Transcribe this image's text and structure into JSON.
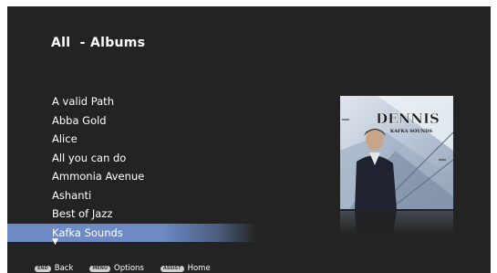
{
  "header": {
    "title": "All  - Albums"
  },
  "albums": [
    {
      "label": "A valid Path"
    },
    {
      "label": "Abba Gold"
    },
    {
      "label": "Alice"
    },
    {
      "label": "All you can do"
    },
    {
      "label": "Ammonia Avenue"
    },
    {
      "label": "Ashanti"
    },
    {
      "label": "Best of Jazz"
    },
    {
      "label": "Kafka Sounds",
      "selected": true
    }
  ],
  "more_indicator": "▼",
  "album_art": {
    "artist": "DENNIS",
    "album": "KAFKA SOUNDS"
  },
  "footer": {
    "hints": [
      {
        "key": "END",
        "label": "Back"
      },
      {
        "key": "MENU",
        "label": "Options"
      },
      {
        "key": "ASSIST",
        "label": "Home"
      }
    ]
  },
  "colors": {
    "background": "#232323",
    "selection": "#6d8ac4",
    "text": "#ffffff"
  }
}
